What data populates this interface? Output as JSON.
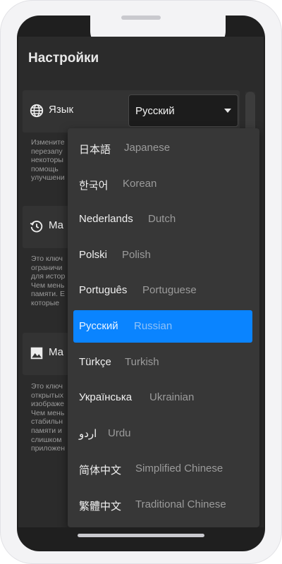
{
  "screen": {
    "title": "Настройки"
  },
  "settings": [
    {
      "icon": "globe-icon",
      "label": "Язык",
      "description": "Измените\nперезапу\nнекоторы\nпомощь\nулучшени"
    },
    {
      "icon": "history-icon",
      "label": "Ма",
      "description": "Это ключ\nограничи\nдля истор\nЧем мень\nпамяти. Е\nкоторые"
    },
    {
      "icon": "image-icon",
      "label": "Ма",
      "description": "Это ключ\nоткрытых\nизображе\nЧем мень\nстабильн\nпамяти и\nслишком\nприложен"
    }
  ],
  "language_select": {
    "value": "Русский"
  },
  "language_options": [
    {
      "native": "日本語",
      "english": "Japanese",
      "selected": false
    },
    {
      "native": "한국어",
      "english": "Korean",
      "selected": false
    },
    {
      "native": "Nederlands",
      "english": "Dutch",
      "selected": false
    },
    {
      "native": "Polski",
      "english": "Polish",
      "selected": false
    },
    {
      "native": "Português",
      "english": "Portuguese",
      "selected": false
    },
    {
      "native": "Русский",
      "english": "Russian",
      "selected": true
    },
    {
      "native": "Türkçe",
      "english": "Turkish",
      "selected": false
    },
    {
      "native": "Українська",
      "english": "Ukrainian",
      "selected": false
    },
    {
      "native": "اردو",
      "english": "Urdu",
      "selected": false
    },
    {
      "native": "简体中文",
      "english": "Simplified Chinese",
      "selected": false
    },
    {
      "native": "繁體中文",
      "english": "Traditional Chinese",
      "selected": false
    }
  ],
  "colors": {
    "accent": "#0a84ff",
    "background": "#2b2b2b",
    "card": "#333333",
    "dropdown": "#373737"
  }
}
